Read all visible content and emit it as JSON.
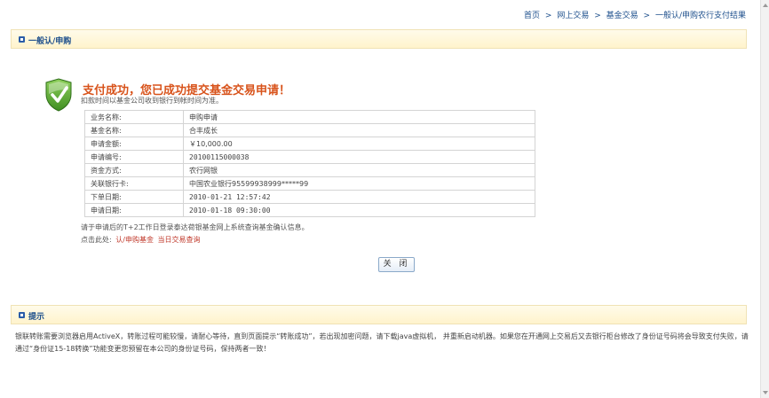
{
  "breadcrumb": {
    "items": [
      "首页",
      "网上交易",
      "基金交易",
      "一般认/申购农行支付结果"
    ],
    "separator": ">"
  },
  "section1": {
    "title": "一般认/申购"
  },
  "result": {
    "title": "支付成功，您已成功提交基金交易申请！",
    "subtitle": "扣款时间以基金公司收到银行到帐时间为准。",
    "rows": [
      {
        "label": "业务名称:",
        "value": "申购申请"
      },
      {
        "label": "基金名称:",
        "value": "合丰成长"
      },
      {
        "label": "申请金额:",
        "value": "￥10,000.00"
      },
      {
        "label": "申请编号:",
        "value": "20100115000038"
      },
      {
        "label": "资金方式:",
        "value": "农行网银"
      },
      {
        "label": "关联银行卡:",
        "value": "中国农业银行95599938999*****99"
      },
      {
        "label": "下单日期:",
        "value": "2010-01-21 12:57:42"
      },
      {
        "label": "申请日期:",
        "value": "2010-01-18 09:30:00"
      }
    ]
  },
  "notes": {
    "line1": "请于申请后的T+2工作日登录泰达荷银基金网上系统查询基金确认信息。",
    "line2_prefix": "点击此处:",
    "link1": "认/申购基金",
    "link2": "当日交易查询"
  },
  "close_button": {
    "label": "关 闭"
  },
  "section2": {
    "title": "提示"
  },
  "tip": {
    "text": "银联转账需要浏览器启用ActiveX，转账过程可能较慢，请耐心等待，直到页面提示“转账成功”，若出现加密问题，请下载java虚拟机， 并重新启动机器。如果您在开通网上交易后又去银行柜台修改了身份证号码将会导致支付失败，请通过“身份证15-18转换”功能变更您预留在本公司的身份证号码，保持两者一致！"
  },
  "colors": {
    "accent_blue": "#1d4f8c",
    "success_orange": "#d8531b",
    "link_red": "#c0392b",
    "shield_green": "#4aa02c"
  }
}
